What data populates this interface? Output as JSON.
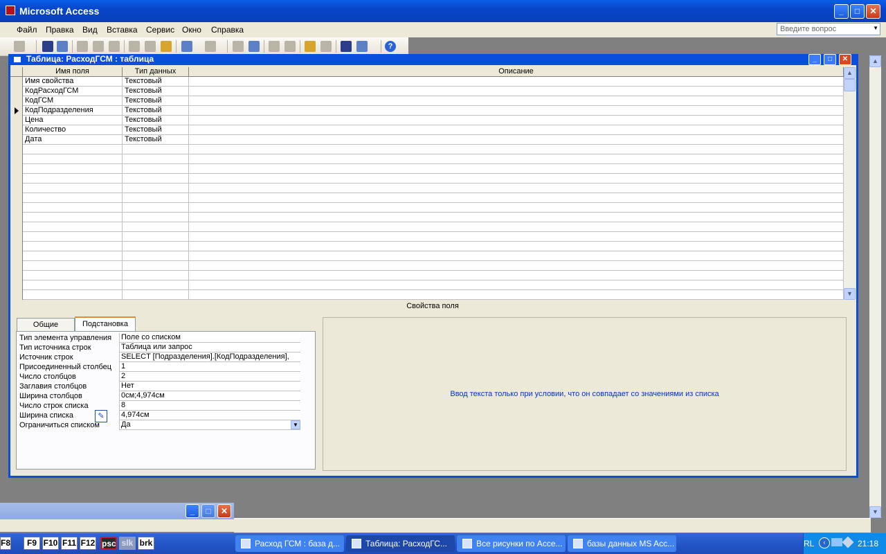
{
  "app": {
    "title": "Microsoft Access"
  },
  "menu": [
    "Файл",
    "Правка",
    "Вид",
    "Вставка",
    "Сервис",
    "Окно",
    "Справка"
  ],
  "ask_placeholder": "Введите вопрос",
  "window": {
    "title": "Таблица: РасходГСМ : таблица"
  },
  "table": {
    "headers": [
      "Имя поля",
      "Тип данных",
      "Описание"
    ],
    "rows": [
      {
        "name": "Имя свойства",
        "type": "Текстовый"
      },
      {
        "name": "КодРасходГСМ",
        "type": "Текстовый"
      },
      {
        "name": "КодГСМ",
        "type": "Текстовый"
      },
      {
        "name": "КодПодразделения",
        "type": "Текстовый"
      },
      {
        "name": "Цена",
        "type": "Текстовый"
      },
      {
        "name": "Количество",
        "type": "Текстовый"
      },
      {
        "name": "Дата",
        "type": "Текстовый"
      }
    ],
    "current_row": 3
  },
  "field_props": {
    "heading": "Свойства поля",
    "tabs": [
      "Общие",
      "Подстановка"
    ],
    "active_tab": 1,
    "rows": [
      {
        "label": "Тип элемента управления",
        "value": "Поле со списком"
      },
      {
        "label": "Тип источника строк",
        "value": "Таблица или запрос"
      },
      {
        "label": "Источник строк",
        "value": "SELECT [Подразделения].[КодПодразделения],"
      },
      {
        "label": "Присоединенный столбец",
        "value": "1"
      },
      {
        "label": "Число столбцов",
        "value": "2"
      },
      {
        "label": "Заглавия столбцов",
        "value": "Нет"
      },
      {
        "label": "Ширина столбцов",
        "value": "0см;4,974см"
      },
      {
        "label": "Число строк списка",
        "value": "8"
      },
      {
        "label": "Ширина списка",
        "value": "4,974см"
      },
      {
        "label": "Ограничиться списком",
        "value": "Да"
      }
    ],
    "hint": "Ввод текста только при условии, что он совпадает со значениями из списка"
  },
  "taskbar": {
    "fkeys": [
      "F8",
      "F9",
      "F10",
      "F11",
      "F12",
      "psc",
      "slk",
      "brk"
    ],
    "tasks": [
      "Расход ГСМ : база д...",
      "Таблица: РасходГС...",
      "Все рисунки по Acce...",
      "базы данных MS Acc..."
    ],
    "active_task": 1,
    "lang": "RL",
    "clock": "21:18"
  }
}
